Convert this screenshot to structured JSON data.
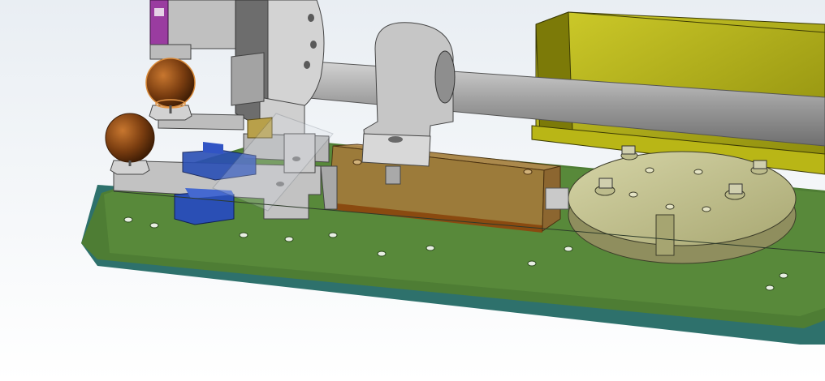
{
  "viewport": {
    "background_top": "#e9eef3",
    "background_bottom": "#ffffff"
  },
  "colors": {
    "base_plate": "#4e7d34",
    "base_plate_top": "#5b8f3d",
    "base_plate_edge": "#2f6f6a",
    "motor_body": "#b8b515",
    "motor_shadow": "#6e6c08",
    "shaft": "#9a9a9a",
    "bearing_block": "#c6c6c6",
    "sensor_box": "#a97a36",
    "rotary_disk": "#c4c38f",
    "blue_block": "#2a4fb5",
    "knob": "#7a3d10",
    "knob_highlight": "#d88a3a",
    "purple_part": "#9a3ca0",
    "steel_dark": "#4a4a4a"
  }
}
